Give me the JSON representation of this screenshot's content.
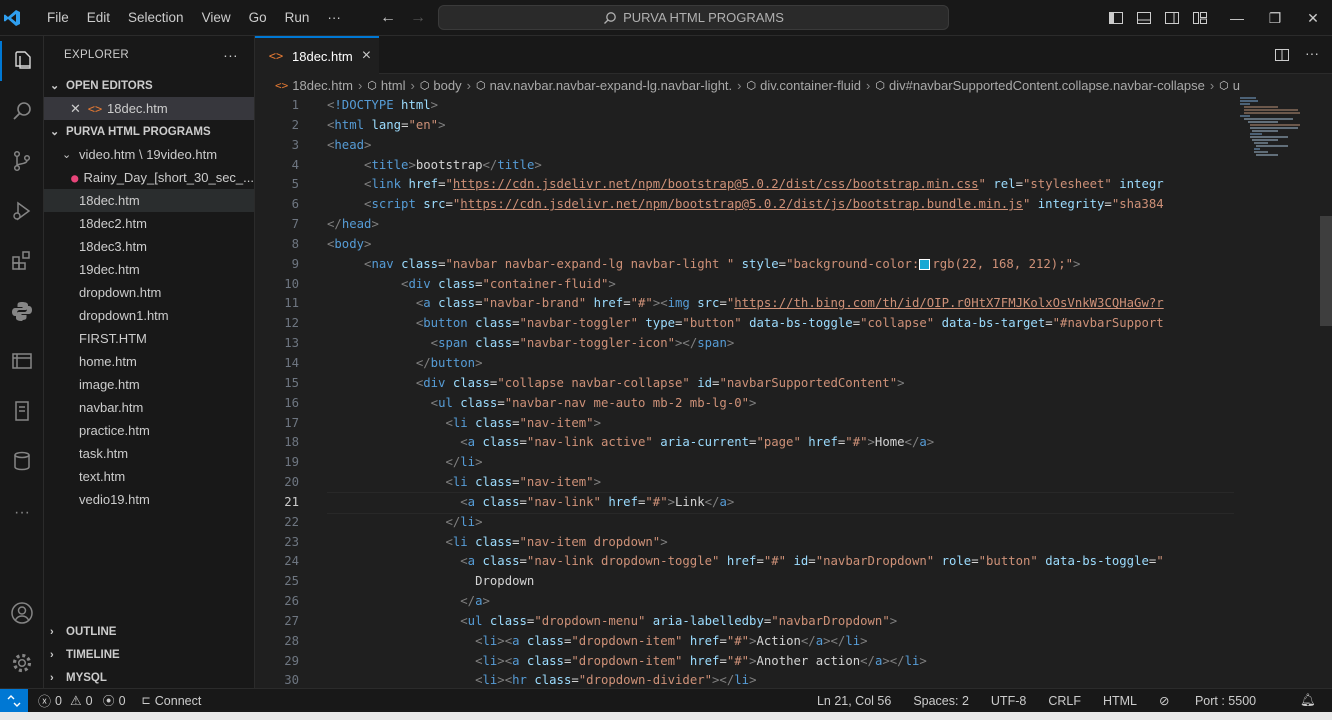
{
  "titlebar": {
    "menu": [
      "File",
      "Edit",
      "Selection",
      "View",
      "Go",
      "Run",
      "···"
    ],
    "search": "PURVA HTML PROGRAMS"
  },
  "activity_icons": [
    "files-icon",
    "search-icon",
    "source-control-icon",
    "run-debug-icon",
    "extensions-icon",
    "python-icon",
    "remote-explorer-icon",
    "notebook-icon",
    "database-icon",
    "more-icon",
    "account-icon",
    "settings-gear-icon"
  ],
  "sidebar": {
    "title": "EXPLORER",
    "more": "···",
    "open_editors": {
      "label": "OPEN EDITORS",
      "items": [
        {
          "name": "18dec.htm"
        }
      ]
    },
    "workspace": {
      "label": "PURVA HTML PROGRAMS",
      "folder": "video.htm \\ 19video.htm",
      "folder_child": "Rainy_Day_[short_30_sec_...",
      "files": [
        "18dec.htm",
        "18dec2.htm",
        "18dec3.htm",
        "19dec.htm",
        "dropdown.htm",
        "dropdown1.htm",
        "FIRST.HTM",
        "home.htm",
        "image.htm",
        "navbar.htm",
        "practice.htm",
        "task.htm",
        "text.htm",
        "vedio19.htm"
      ]
    },
    "bottom_sections": [
      "OUTLINE",
      "TIMELINE",
      "MYSQL"
    ]
  },
  "tab": {
    "label": "18dec.htm",
    "close": "×"
  },
  "breadcrumb": [
    "18dec.htm",
    "html",
    "body",
    "nav.navbar.navbar-expand-lg.navbar-light.",
    "div.container-fluid",
    "div#navbarSupportedContent.collapse.navbar-collapse",
    "u"
  ],
  "editor": {
    "current_line": 21,
    "line_numbers": [
      "1",
      "2",
      "3",
      "4",
      "5",
      "6",
      "7",
      "8",
      "9",
      "10",
      "11",
      "12",
      "13",
      "14",
      "15",
      "16",
      "17",
      "18",
      "19",
      "20",
      "21",
      "22",
      "23",
      "24",
      "25",
      "26",
      "27",
      "28",
      "29",
      "30"
    ]
  },
  "status": {
    "errors": "0",
    "warnings": "0",
    "ports": "0",
    "connect": "Connect",
    "position": "Ln 21, Col 56",
    "spaces": "Spaces: 2",
    "encoding": "UTF-8",
    "eol": "CRLF",
    "language": "HTML",
    "port": "Port : 5500"
  }
}
